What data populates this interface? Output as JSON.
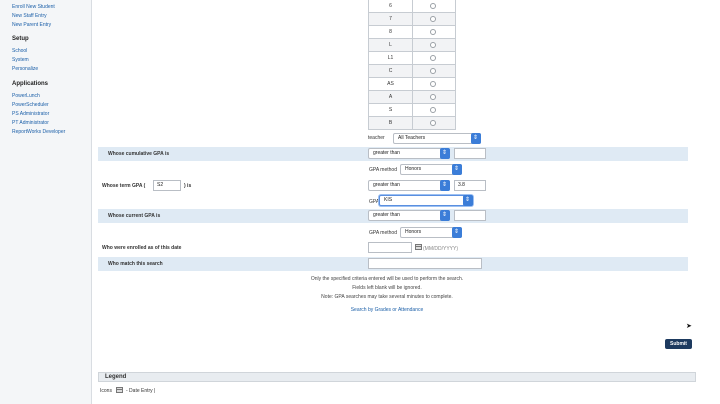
{
  "sidebar": {
    "links_top": [
      "Enroll New Student",
      "New Staff Entry",
      "New Parent Entry"
    ],
    "setup": {
      "heading": "Setup",
      "items": [
        "School",
        "System",
        "Personalize"
      ]
    },
    "applications": {
      "heading": "Applications",
      "items": [
        "PowerLunch",
        "PowerScheduler",
        "PS Administrator",
        "PT Administrator",
        "ReportWorks Developer"
      ]
    }
  },
  "grades": {
    "rows": [
      "6",
      "7",
      "8",
      "L",
      "L1",
      "C",
      "AS",
      "A",
      "S",
      "B"
    ]
  },
  "teacher": {
    "label": "teacher",
    "value": "All Teachers"
  },
  "cumulative_gpa": {
    "label": "Whose cumulative GPA is",
    "comparator": "greater than",
    "value": "",
    "method_label": "GPA method",
    "method": "Honors"
  },
  "term_gpa": {
    "label_before": "Whose term GPA (",
    "term": "S2",
    "label_after": ") is",
    "comparator": "greater than",
    "value": "3.8",
    "method_label": "GPA method",
    "method": "KIS"
  },
  "current_gpa": {
    "label": "Whose current GPA is",
    "comparator": "greater than",
    "value": "",
    "method_label": "GPA method",
    "method": "Honors"
  },
  "enrolled": {
    "label": "Who were enrolled as of this date",
    "placeholder": "(MM/DD/YYYY)"
  },
  "match": {
    "label": "Who match this search",
    "value": ""
  },
  "notes": [
    "Only the specified criteria entered will be used to perform the search.",
    "Fields left blank will be ignored.",
    "Note: GPA searches may take several minutes to complete."
  ],
  "search_link": "Search by Grades or Attendance",
  "submit_label": "Submit",
  "legend": {
    "title": "Legend",
    "icons_label": "Icons",
    "date_entry_label": "- Date Entry |"
  }
}
